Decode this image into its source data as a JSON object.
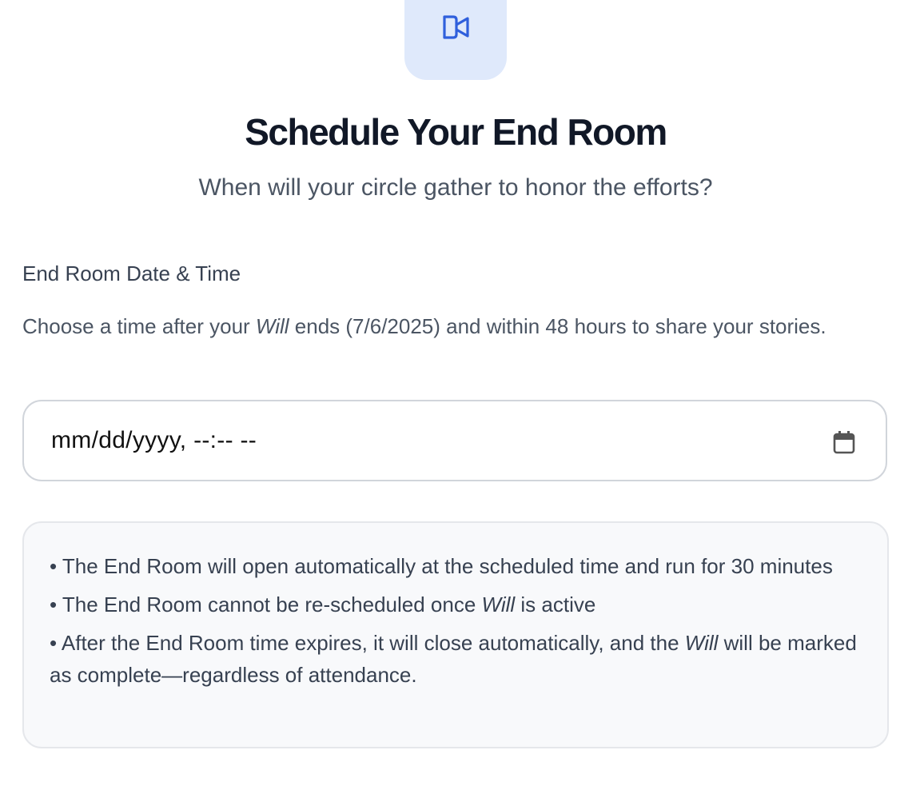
{
  "header": {
    "icon": "video-camera-icon",
    "title": "Schedule Your End Room",
    "subtitle": "When will your circle gather to honor the efforts?"
  },
  "form": {
    "label": "End Room Date & Time",
    "help": {
      "part1": "Choose a time after your ",
      "em": "Will",
      "part2": " ends (7/6/2025) and within 48 hours to share your stories."
    },
    "input": {
      "placeholder": "mm/dd/yyyy, --:-- --",
      "icon": "calendar-icon"
    }
  },
  "notes": [
    {
      "before": "• The End Room will open automatically at the scheduled time and run for 30 minutes",
      "em": "",
      "after": ""
    },
    {
      "before": "• The End Room cannot be re-scheduled once ",
      "em": "Will",
      "after": " is active"
    },
    {
      "before": "• After the End Room time expires, it will close automatically, and the ",
      "em": "Will",
      "after": " will be marked as complete—regardless of attendance."
    }
  ],
  "colors": {
    "accent": "#2f5fdc",
    "icon_tile": "#dfe9fb",
    "title": "#111827",
    "muted": "#4b5563"
  }
}
